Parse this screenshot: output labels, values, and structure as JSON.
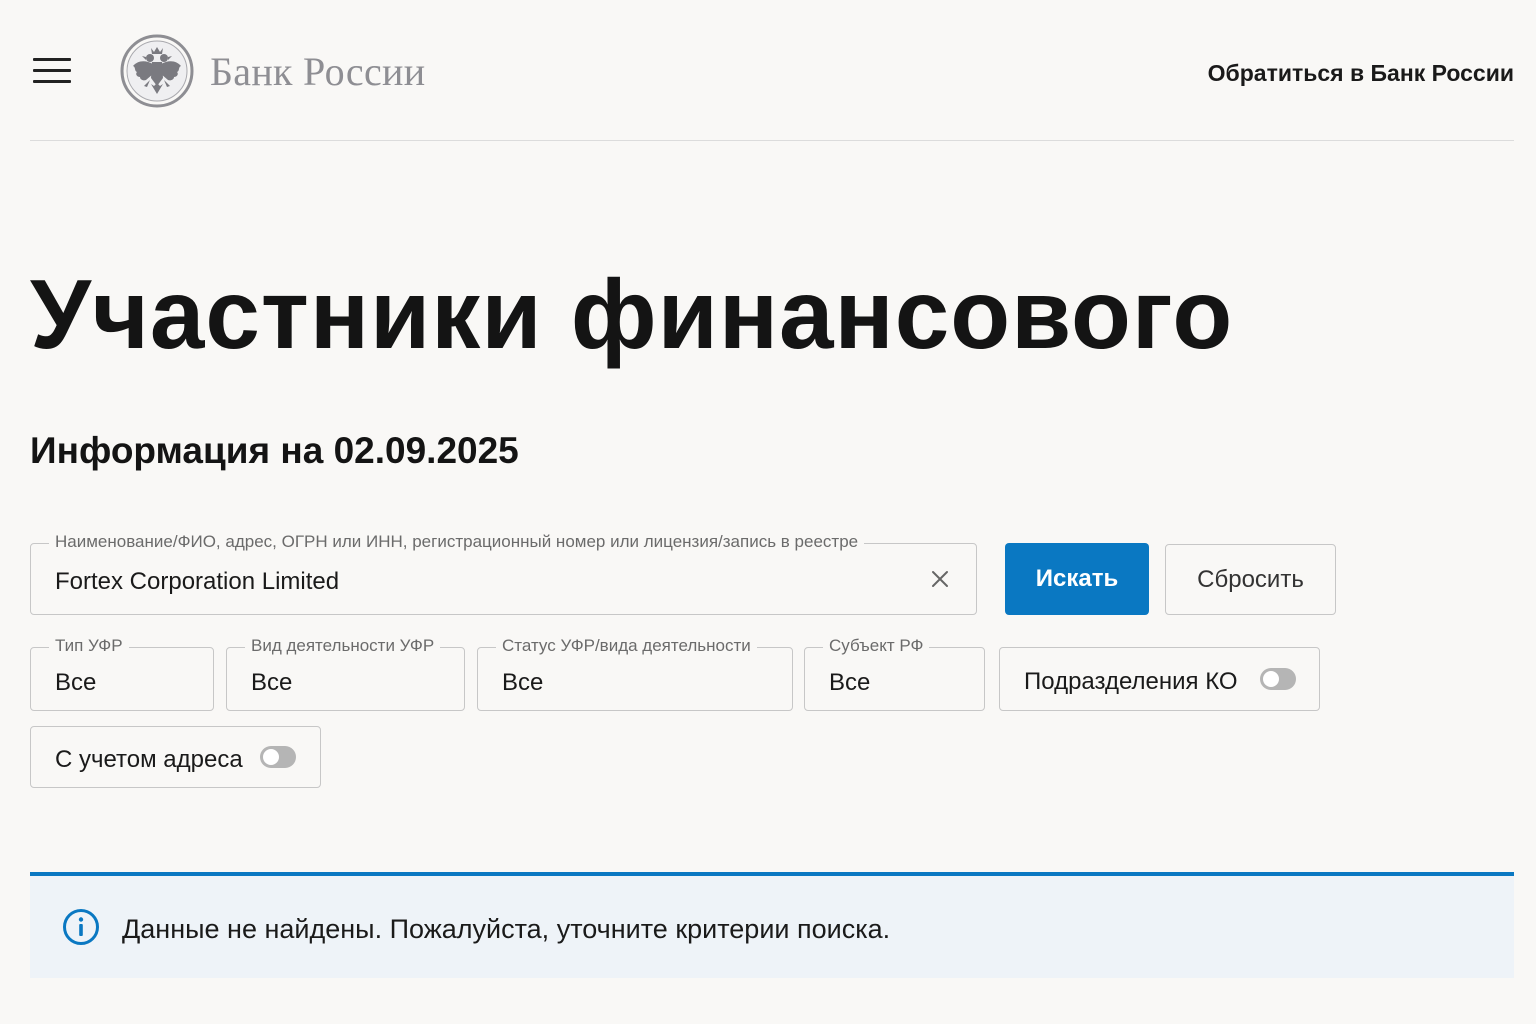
{
  "header": {
    "menu_icon": "hamburger-menu-icon",
    "logo_icon": "double-headed-eagle-emblem",
    "logo_text": "Банк России",
    "contact_link": "Обратиться в Банк России"
  },
  "main": {
    "title": "Участники финансового",
    "subtitle": "Информация на 02.09.2025"
  },
  "search": {
    "label": "Наименование/ФИО, адрес, ОГРН или ИНН, регистрационный номер или лицензия/запись в реестре",
    "value": "Fortex Corporation Limited",
    "clear_icon": "close-icon",
    "search_button": "Искать",
    "reset_button": "Сбросить"
  },
  "filters": [
    {
      "label": "Тип УФР",
      "value": "Все"
    },
    {
      "label": "Вид деятельности УФР",
      "value": "Все"
    },
    {
      "label": "Статус УФР/вида деятельности",
      "value": "Все"
    },
    {
      "label": "Субъект РФ",
      "value": "Все"
    }
  ],
  "toggles": [
    {
      "label": "Подразделения КО",
      "enabled": false
    },
    {
      "label": "С учетом адреса",
      "enabled": false
    }
  ],
  "notice": {
    "icon": "info-icon",
    "text": "Данные не найдены. Пожалуйста, уточните критерии поиска."
  },
  "colors": {
    "accent": "#0a78c2",
    "background": "#f9f8f6",
    "notice_background": "#eef3f8",
    "logo_gray": "#8e8e93",
    "switch_off": "#b5b5b5"
  }
}
